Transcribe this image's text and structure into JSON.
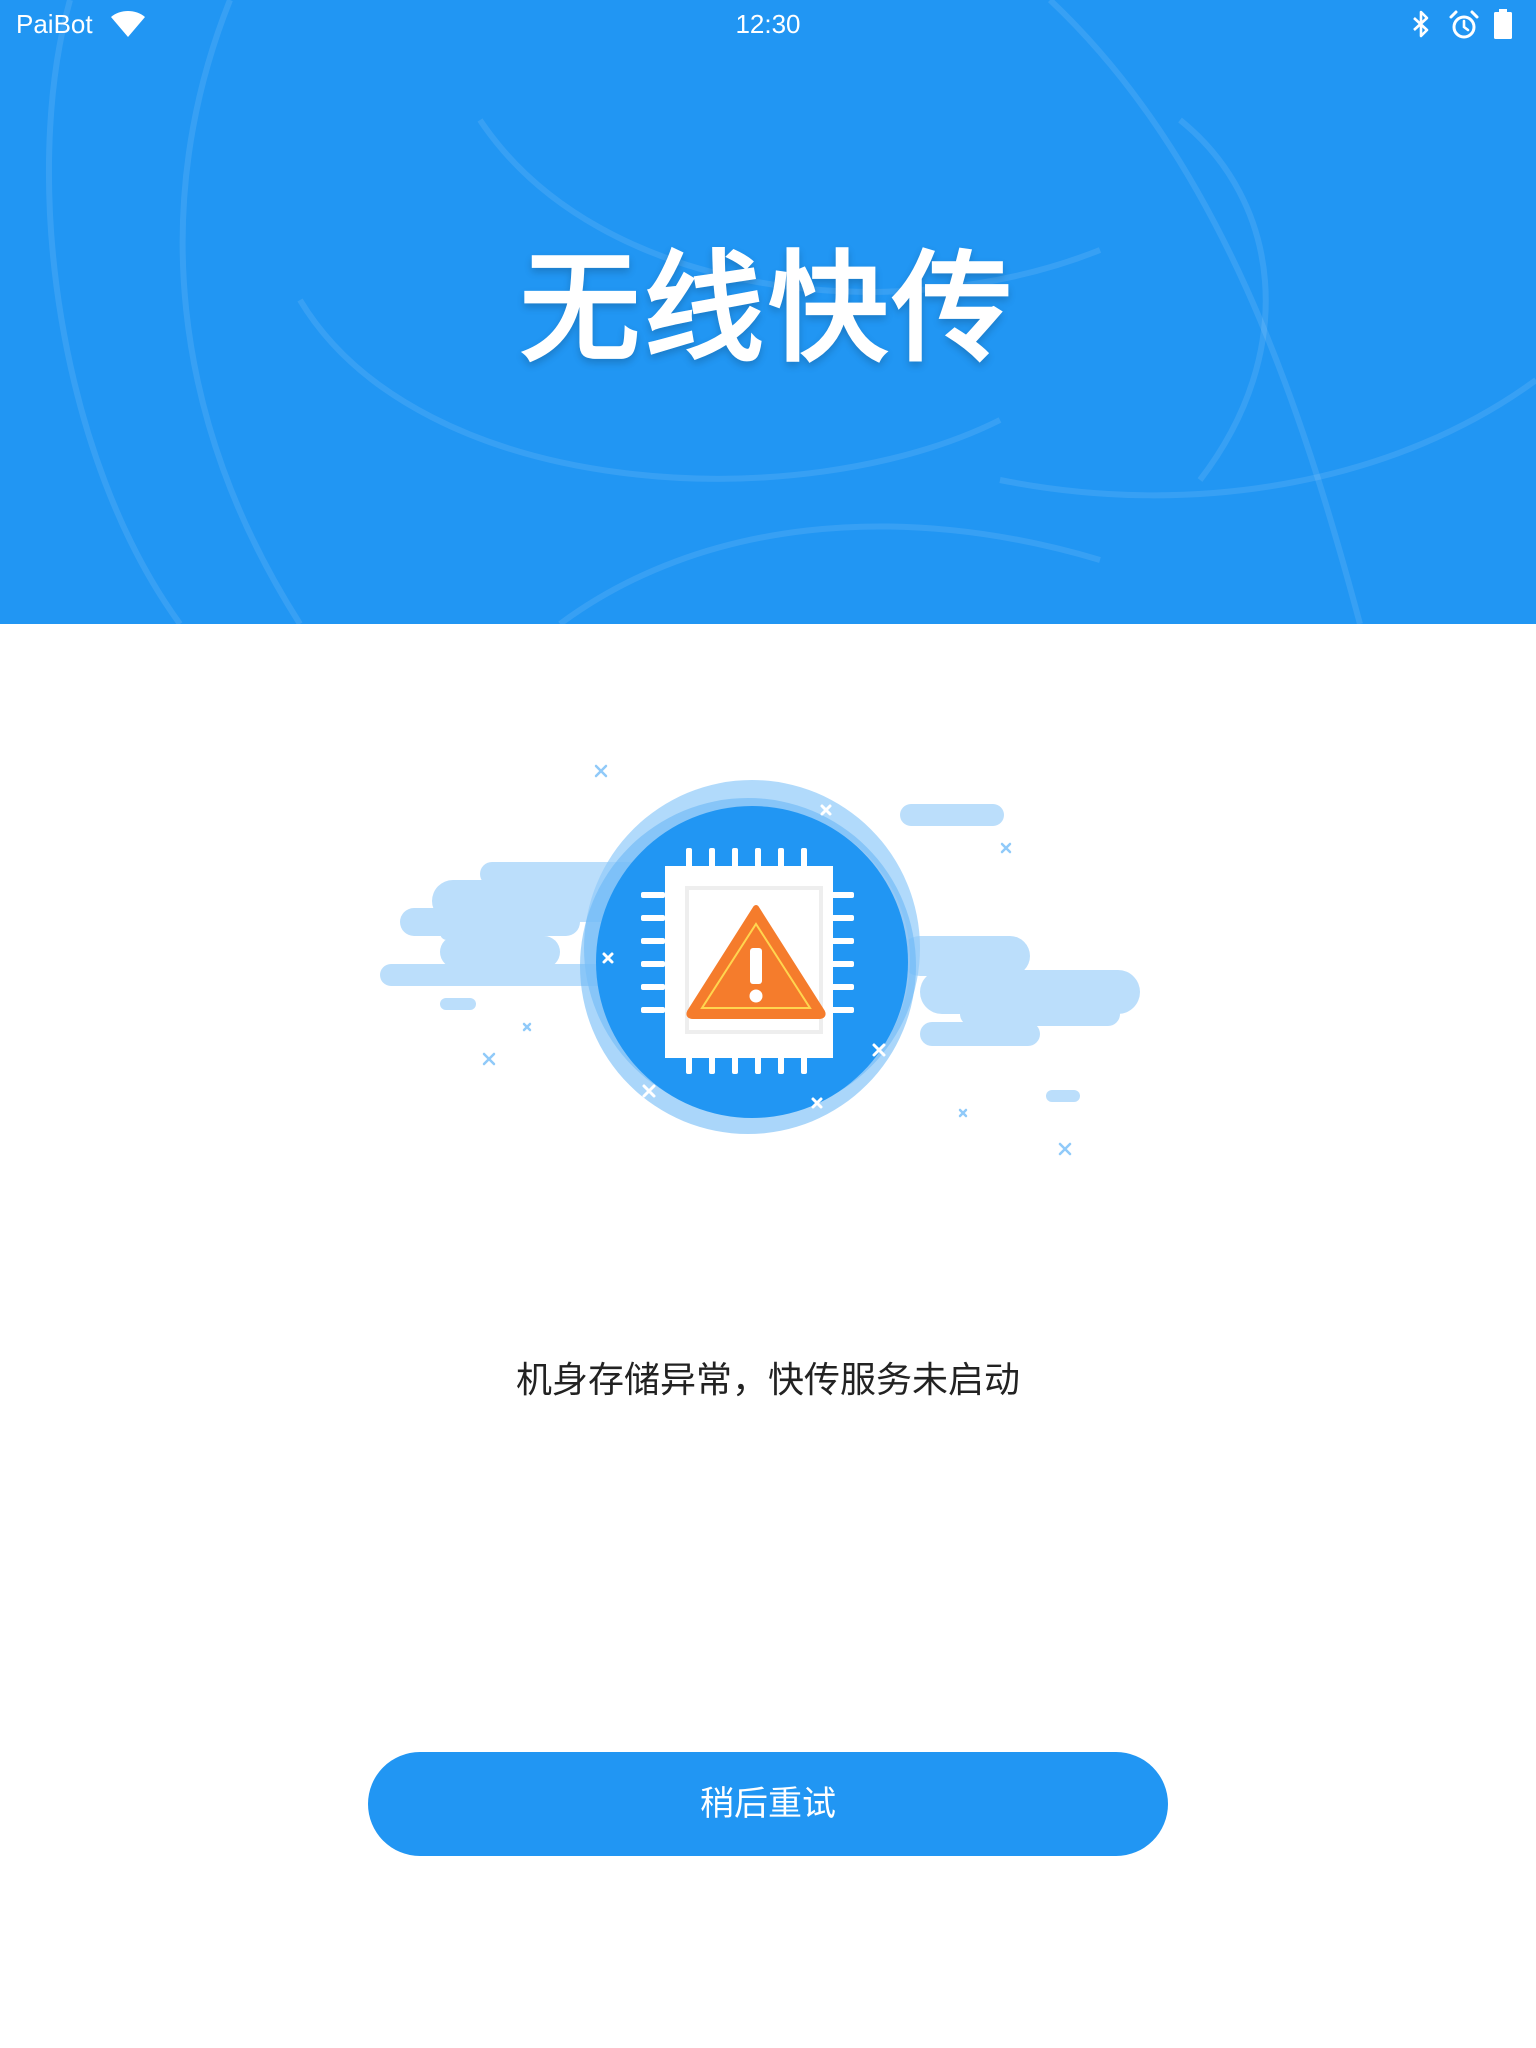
{
  "status_bar": {
    "carrier": "PaiBot",
    "time": "12:30",
    "wifi_icon": "wifi-icon",
    "bluetooth_icon": "bluetooth-icon",
    "alarm_icon": "alarm-icon",
    "battery_icon": "battery-icon"
  },
  "header": {
    "title": "无线快传"
  },
  "illustration": {
    "icon": "chip-warning-icon"
  },
  "message": "机身存储异常，快传服务未启动",
  "retry_button": {
    "label": "稍后重试"
  },
  "colors": {
    "primary": "#2196f3",
    "warning": "#f57c2c",
    "light_blue": "#bbdefb",
    "text": "#222222"
  }
}
